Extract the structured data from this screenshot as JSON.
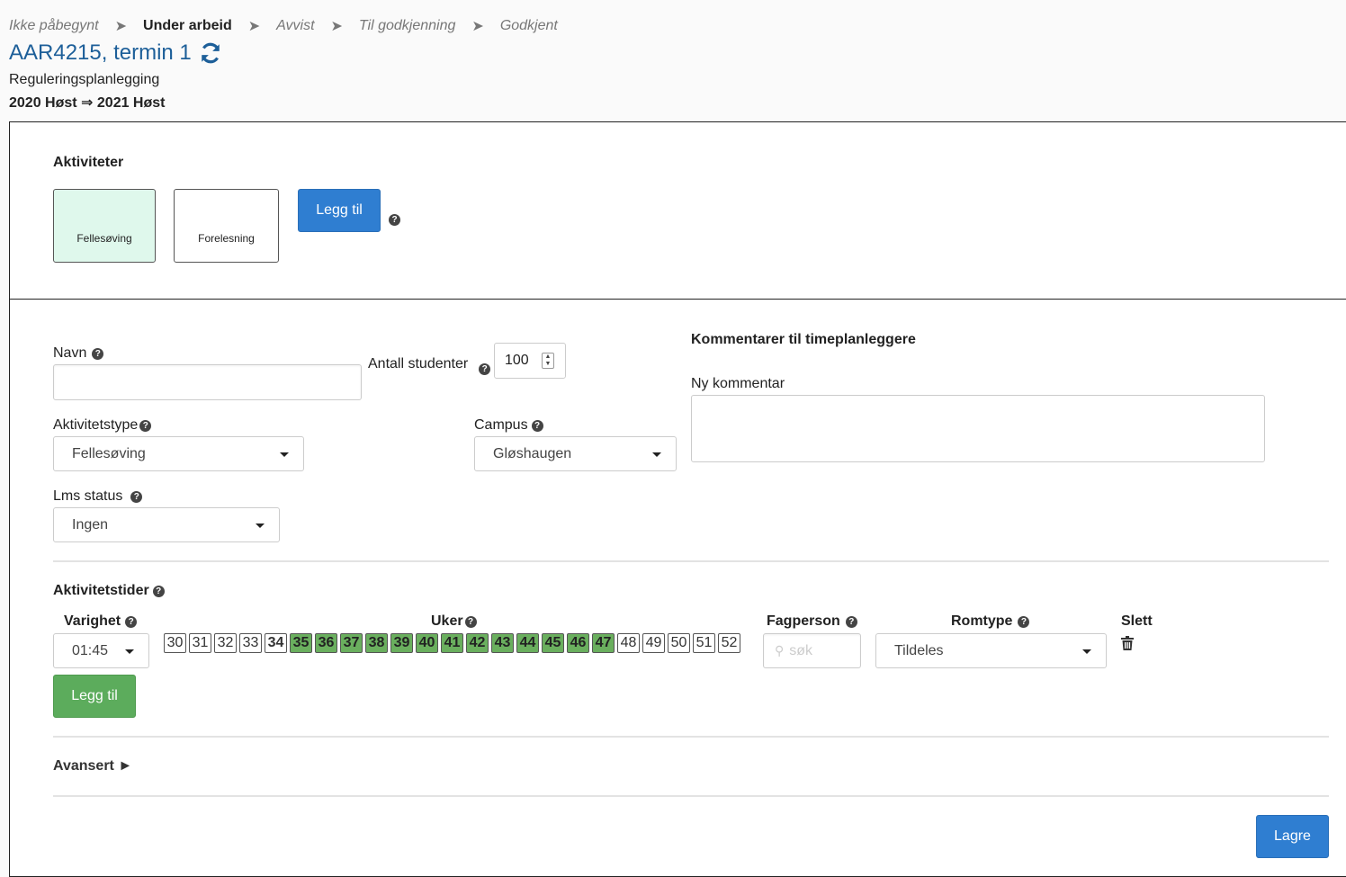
{
  "workflow": {
    "steps": [
      "Ikke påbegynt",
      "Under arbeid",
      "Avvist",
      "Til godkjenning",
      "Godkjent"
    ],
    "active_index": 1
  },
  "course": {
    "title": "AAR4215, termin 1",
    "name": "Reguleringsplanlegging",
    "period": "2020 Høst ⇒ 2021 Høst"
  },
  "activities": {
    "heading": "Aktiviteter",
    "items": [
      {
        "label": "Fellesøving",
        "selected": true
      },
      {
        "label": "Forelesning",
        "selected": false
      }
    ],
    "add_label": "Legg til"
  },
  "form": {
    "name_label": "Navn",
    "name_value": "",
    "students_label": "Antall studenter",
    "students_value": "100",
    "type_label": "Aktivitetstype",
    "type_value": "Fellesøving",
    "campus_label": "Campus",
    "campus_value": "Gløshaugen",
    "lms_label": "Lms status",
    "lms_value": "Ingen"
  },
  "comments": {
    "heading": "Kommentarer til timeplanleggere",
    "new_label": "Ny kommentar",
    "value": ""
  },
  "times": {
    "heading": "Aktivitetstider",
    "duration_label": "Varighet",
    "duration_value": "01:45",
    "weeks_label": "Uker",
    "weeks": [
      {
        "n": "30",
        "state": "off"
      },
      {
        "n": "31",
        "state": "off"
      },
      {
        "n": "32",
        "state": "off"
      },
      {
        "n": "33",
        "state": "off"
      },
      {
        "n": "34",
        "state": "bold"
      },
      {
        "n": "35",
        "state": "on"
      },
      {
        "n": "36",
        "state": "on"
      },
      {
        "n": "37",
        "state": "on"
      },
      {
        "n": "38",
        "state": "on"
      },
      {
        "n": "39",
        "state": "on"
      },
      {
        "n": "40",
        "state": "on"
      },
      {
        "n": "41",
        "state": "on"
      },
      {
        "n": "42",
        "state": "on"
      },
      {
        "n": "43",
        "state": "on"
      },
      {
        "n": "44",
        "state": "on"
      },
      {
        "n": "45",
        "state": "on"
      },
      {
        "n": "46",
        "state": "on"
      },
      {
        "n": "47",
        "state": "on"
      },
      {
        "n": "48",
        "state": "off"
      },
      {
        "n": "49",
        "state": "off"
      },
      {
        "n": "50",
        "state": "off"
      },
      {
        "n": "51",
        "state": "off"
      },
      {
        "n": "52",
        "state": "off"
      }
    ],
    "person_label": "Fagperson",
    "person_placeholder": "søk",
    "room_label": "Romtype",
    "room_value": "Tildeles",
    "delete_label": "Slett",
    "add_label": "Legg til"
  },
  "advanced_label": "Avansert ►",
  "save_label": "Lagre",
  "help_glyph": "?",
  "colors": {
    "title_blue": "#1d5f99",
    "primary": "#2f7ed1",
    "success": "#5cac5c",
    "week_on": "#6aaf5e",
    "selected_activity": "#dff8ec"
  }
}
